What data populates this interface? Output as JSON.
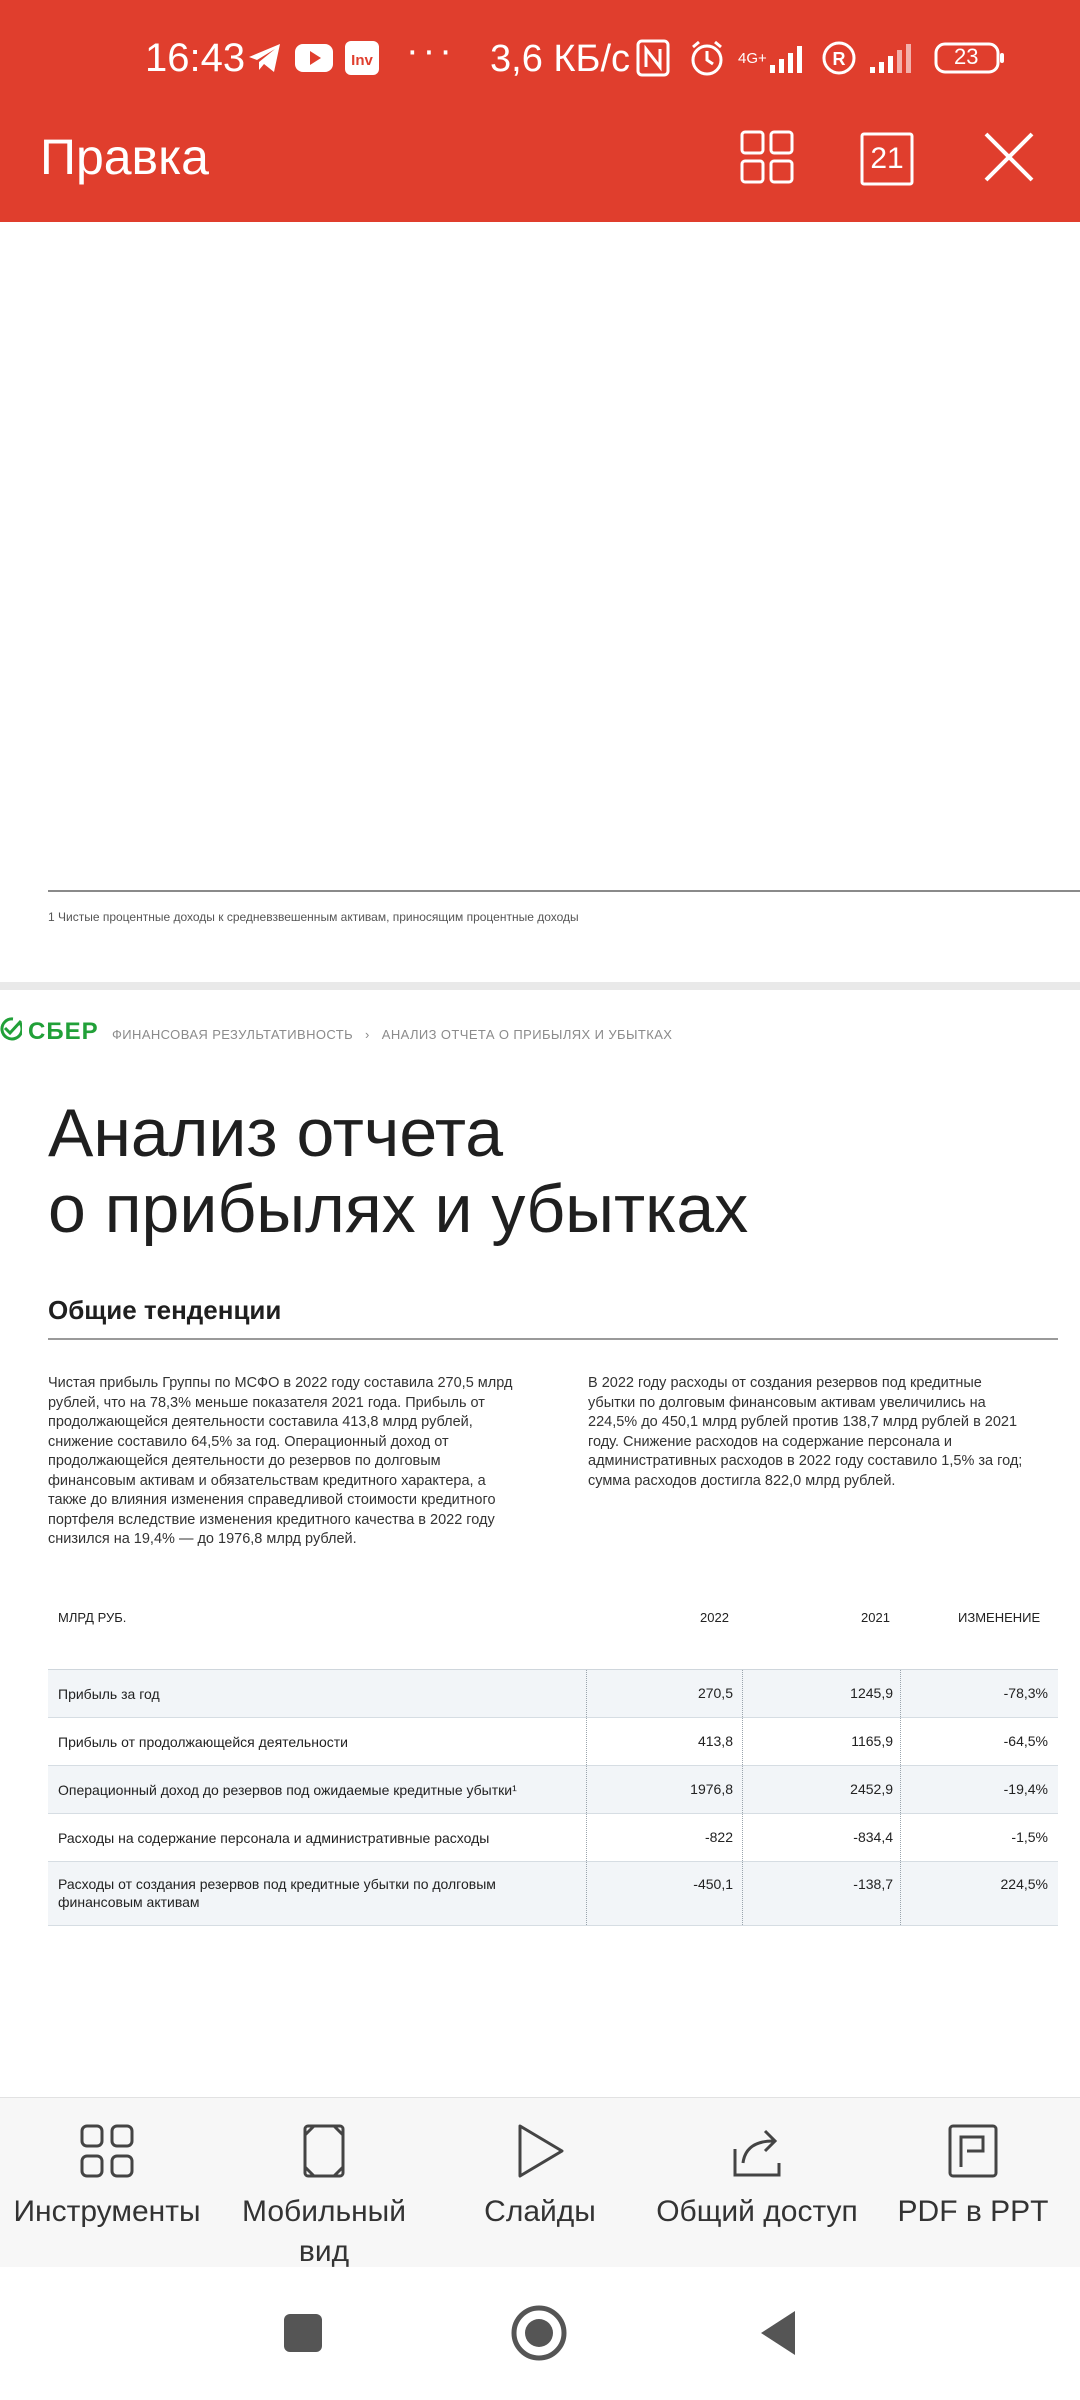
{
  "status": {
    "time": "16:43",
    "dots": "···",
    "speed": "3,6 КБ/с",
    "network": "4G+",
    "battery": "23"
  },
  "toolbar": {
    "title": "Правка",
    "page_count": "21"
  },
  "document": {
    "footnote": "1   Чистые процентные доходы к средневзвешенным активам, приносящим процентные доходы",
    "logo_text": "СБЕР",
    "breadcrumb": {
      "section": "ФИНАНСОВАЯ РЕЗУЛЬТАТИВНОСТЬ",
      "separator": "›",
      "page": "АНАЛИЗ ОТЧЕТА О ПРИБЫЛЯХ И УБЫТКАХ"
    },
    "title_line1": "Анализ отчета",
    "title_line2": "о прибылях и убытках",
    "section_title": "Общие тенденции",
    "paragraph_left": "Чистая прибыль Группы по МСФО в 2022 году составила 270,5 млрд рублей, что на 78,3% меньше показателя 2021 года. Прибыль от продолжающейся деятельности составила 413,8 млрд рублей, снижение составило 64,5% за год. Операционный доход от продолжающейся деятельности до резервов по долговым финансовым активам и обязательствам кредитного характера, а также до влияния изменения справедливой стоимости кредитного портфеля вследствие изменения кредитного качества в 2022 году снизился на 19,4% — до 1976,8 млрд рублей.",
    "paragraph_right": "В 2022 году расходы от создания резервов под кредитные убытки по долговым финансовым активам увеличились на 224,5% до 450,1 млрд рублей против 138,7 млрд рублей в 2021 году. Снижение расходов на содержание персонала и административных расходов в 2022 году составило 1,5% за год; сумма расходов достигла 822,0 млрд рублей.",
    "table": {
      "headers": {
        "unit": "МЛРД РУБ.",
        "y2022": "2022",
        "y2021": "2021",
        "change": "ИЗМЕНЕНИЕ"
      },
      "rows": [
        {
          "label": "Прибыль за год",
          "y2022": "270,5",
          "y2021": "1245,9",
          "change": "-78,3%"
        },
        {
          "label": "Прибыль от продолжающейся деятельности",
          "y2022": "413,8",
          "y2021": "1165,9",
          "change": "-64,5%"
        },
        {
          "label": "Операционный доход до резервов под ожидаемые кредитные убытки¹",
          "y2022": "1976,8",
          "y2021": "2452,9",
          "change": "-19,4%"
        },
        {
          "label": "Расходы на содержание персонала и административные расходы",
          "y2022": "-822",
          "y2021": "-834,4",
          "change": "-1,5%"
        },
        {
          "label": "Расходы от создания резервов под кредитные убытки по долговым финансовым активам",
          "y2022": "-450,1",
          "y2021": "-138,7",
          "change": "224,5%"
        }
      ]
    }
  },
  "bottom_bar": {
    "items": [
      {
        "label": "Инструменты",
        "icon": "grid-tools-icon"
      },
      {
        "label": "Мобильный вид",
        "icon": "mobile-view-icon"
      },
      {
        "label": "Слайды",
        "icon": "play-icon"
      },
      {
        "label": "Общий доступ",
        "icon": "share-icon"
      },
      {
        "label": "PDF в PPT",
        "icon": "pdf-to-ppt-icon"
      }
    ]
  },
  "colors": {
    "header": "#e03e2d",
    "sber_green": "#21a038"
  }
}
